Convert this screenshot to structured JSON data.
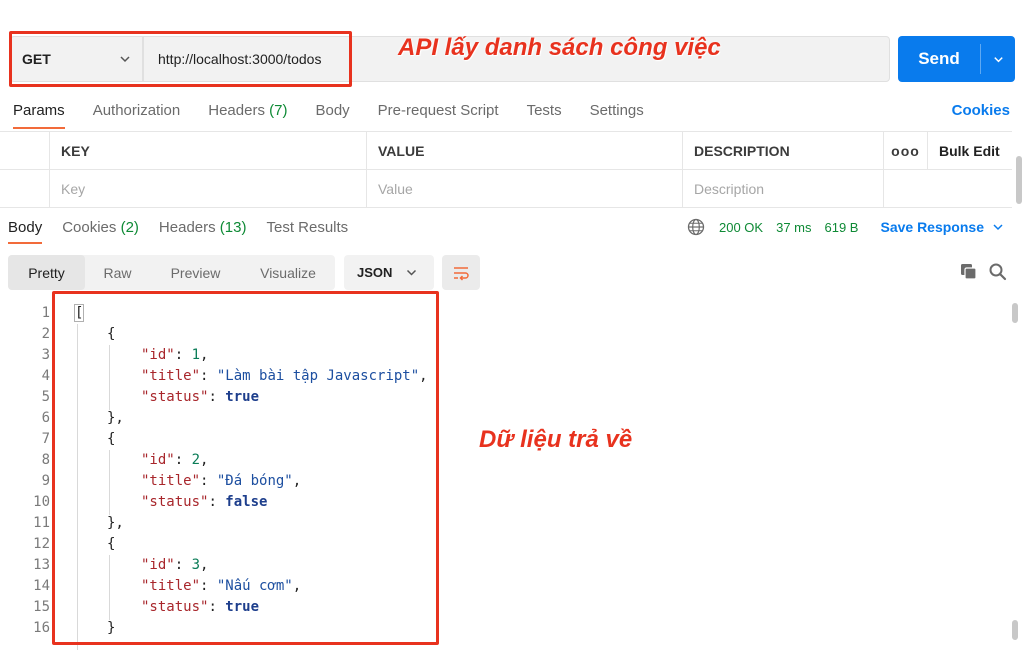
{
  "request": {
    "method": "GET",
    "url": "http://localhost:3000/todos",
    "send_label": "Send"
  },
  "annotations": {
    "api_label": "API lấy danh sách công việc",
    "response_label": "Dữ liệu trả về",
    "color": "#e8321e"
  },
  "request_tabs": {
    "params": "Params",
    "authorization": "Authorization",
    "headers": "Headers",
    "headers_count": "(7)",
    "body": "Body",
    "prerequest": "Pre-request Script",
    "tests": "Tests",
    "settings": "Settings",
    "cookies": "Cookies"
  },
  "params_table": {
    "headers": [
      "KEY",
      "VALUE",
      "DESCRIPTION"
    ],
    "more": "ooo",
    "bulk_edit": "Bulk Edit",
    "placeholders": [
      "Key",
      "Value",
      "Description"
    ]
  },
  "response_tabs": {
    "body": "Body",
    "cookies": "Cookies",
    "cookies_count": "(2)",
    "headers": "Headers",
    "headers_count": "(13)",
    "test_results": "Test Results"
  },
  "response_status": {
    "status": "200 OK",
    "time": "37 ms",
    "size": "619 B",
    "save_response": "Save Response"
  },
  "view_modes": [
    "Pretty",
    "Raw",
    "Preview",
    "Visualize"
  ],
  "format": "JSON",
  "todos": [
    {
      "id": "1",
      "title": "\"Làm bài tập Javascript\"",
      "status": "true"
    },
    {
      "id": "2",
      "title": "\"Đá bóng\"",
      "status": "false"
    },
    {
      "id": "3",
      "title": "\"Nấu cơm\"",
      "status": "true"
    }
  ],
  "json_keys": {
    "id": "\"id\"",
    "title": "\"title\"",
    "status": "\"status\""
  },
  "colors": {
    "accent": "#f26b3a",
    "send": "#097bed",
    "success": "#0e8a35"
  }
}
